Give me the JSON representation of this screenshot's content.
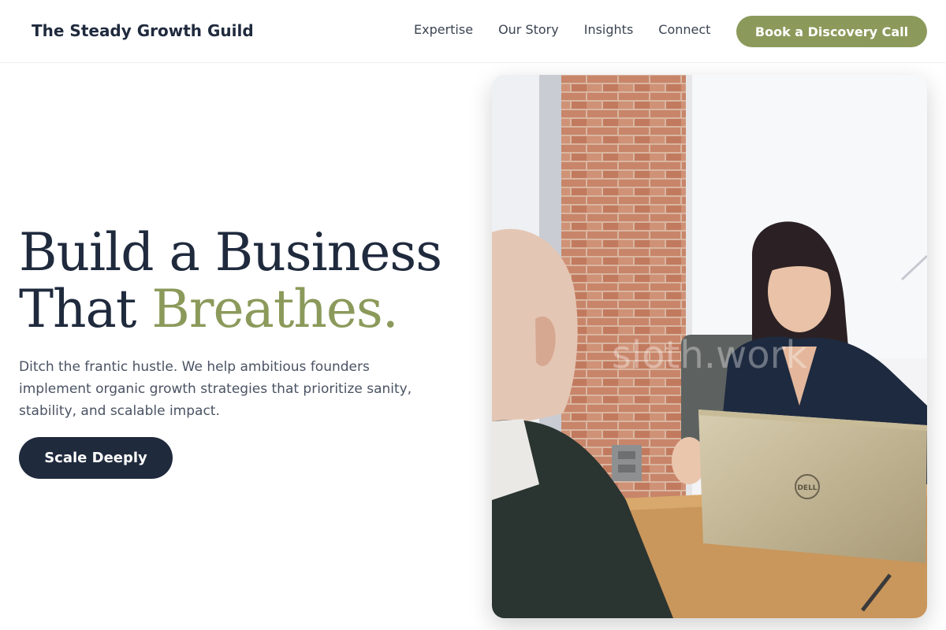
{
  "nav": {
    "brand": "The Steady Growth Guild",
    "links": [
      "Expertise",
      "Our Story",
      "Insights",
      "Connect"
    ],
    "cta_label": "Book a Discovery Call"
  },
  "hero": {
    "headline_line1": "Build a Business",
    "headline_line2_prefix": "That ",
    "headline_line2_accent": "Breathes.",
    "subtext": "Ditch the frantic hustle. We help ambitious founders implement organic growth strategies that prioritize sanity, stability, and scalable impact.",
    "cta_label": "Scale Deeply",
    "image_watermark": "sloth.work",
    "laptop_brand": "DELL"
  },
  "colors": {
    "brand_dark": "#1f2a3d",
    "accent_olive": "#8b9a5b",
    "text_muted": "#4a5363"
  }
}
